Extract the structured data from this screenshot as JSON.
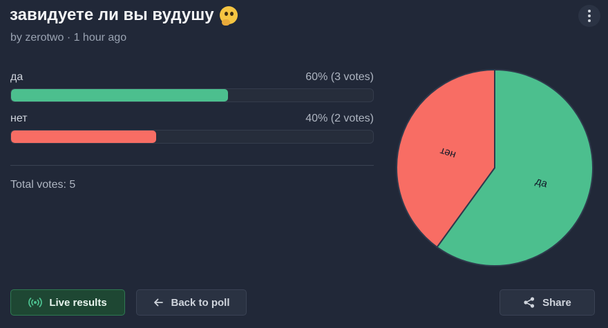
{
  "poll": {
    "title": "завидуете ли вы вудушу",
    "title_emoji": "thinking-face-emoji",
    "meta": "by zerotwo · 1 hour ago",
    "total": "Total votes: 5"
  },
  "options": [
    {
      "label": "да",
      "stat": "60% (3 votes)",
      "percent": 60,
      "color": "#4cbf8e"
    },
    {
      "label": "нет",
      "stat": "40% (2 votes)",
      "percent": 40,
      "color": "#f86d64"
    }
  ],
  "chart_data": {
    "type": "pie",
    "categories": [
      "да",
      "нет"
    ],
    "values": [
      60,
      40
    ],
    "colors": [
      "#4cbf8e",
      "#f86d64"
    ],
    "title": "",
    "legend": "none"
  },
  "buttons": {
    "live": "Live results",
    "back": "Back to poll",
    "share": "Share"
  },
  "icons": {
    "menu": "more-vertical-icon",
    "live": "broadcast-icon",
    "back": "arrow-left-icon",
    "share": "share-icon"
  }
}
